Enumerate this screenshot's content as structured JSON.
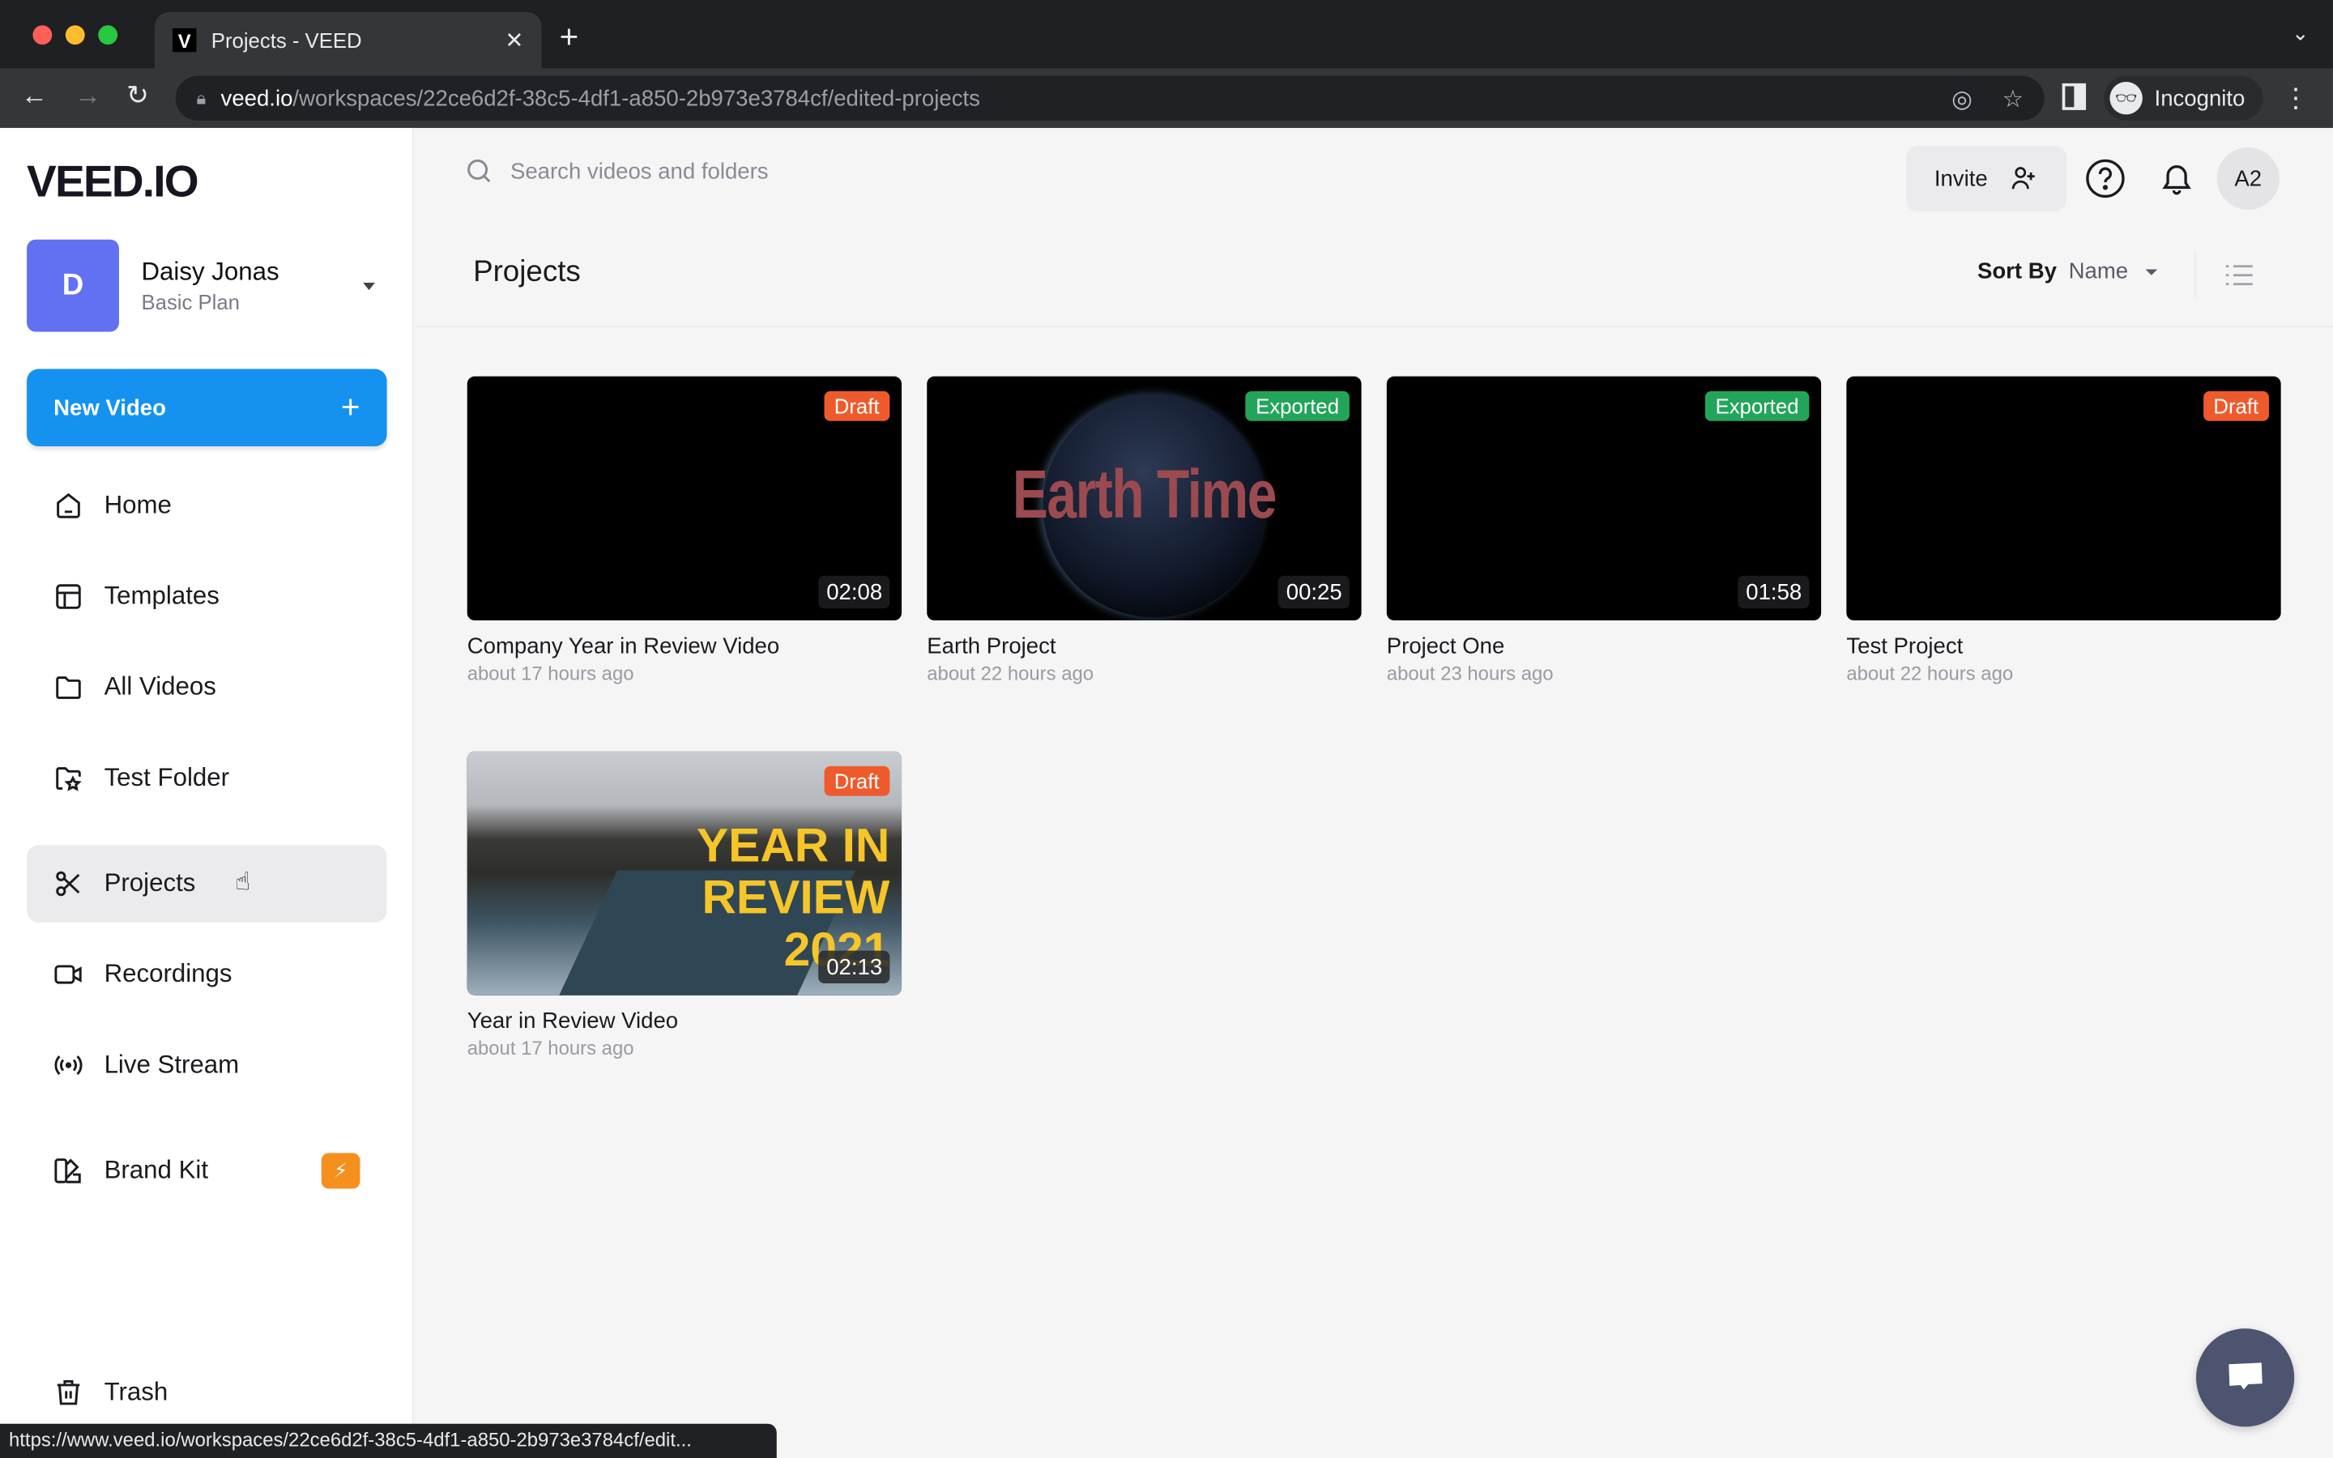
{
  "browser": {
    "tab_title": "Projects - VEED",
    "tab_favicon": "V",
    "url_host": "veed.io",
    "url_path": "/workspaces/22ce6d2f-38c5-4df1-a850-2b973e3784cf/edited-projects",
    "profile_label": "Incognito",
    "status_url": "https://www.veed.io/workspaces/22ce6d2f-38c5-4df1-a850-2b973e3784cf/edit..."
  },
  "sidebar": {
    "logo": "VEED.IO",
    "account": {
      "initial": "D",
      "name": "Daisy Jonas",
      "plan": "Basic Plan"
    },
    "new_video_label": "New Video",
    "items": [
      {
        "label": "Home",
        "icon": "home-icon"
      },
      {
        "label": "Templates",
        "icon": "templates-icon"
      },
      {
        "label": "All Videos",
        "icon": "folder-icon"
      },
      {
        "label": "Test Folder",
        "icon": "folder-star-icon"
      },
      {
        "label": "Projects",
        "icon": "scissors-icon",
        "active": true
      },
      {
        "label": "Recordings",
        "icon": "video-camera-icon"
      },
      {
        "label": "Live Stream",
        "icon": "broadcast-icon"
      },
      {
        "label": "Brand Kit",
        "icon": "brand-kit-icon",
        "badge": "lightning-icon"
      },
      {
        "label": "Trash",
        "icon": "trash-icon"
      }
    ]
  },
  "header": {
    "search_placeholder": "Search videos and folders",
    "invite_label": "Invite",
    "user_initials": "A2"
  },
  "page": {
    "title": "Projects",
    "sort_label": "Sort By",
    "sort_value": "Name"
  },
  "projects": [
    {
      "title": "Company Year in Review Video",
      "time": "about 17 hours ago",
      "status": "Draft",
      "duration": "02:08",
      "thumb": "black"
    },
    {
      "title": "Earth Project",
      "time": "about 22 hours ago",
      "status": "Exported",
      "duration": "00:25",
      "thumb": "earth",
      "thumb_text": "Earth Time"
    },
    {
      "title": "Project One",
      "time": "about 23 hours ago",
      "status": "Exported",
      "duration": "01:58",
      "thumb": "black"
    },
    {
      "title": "Test Project",
      "time": "about 22 hours ago",
      "status": "Draft",
      "duration": "",
      "thumb": "black"
    },
    {
      "title": "Year in Review Video",
      "time": "about 17 hours ago",
      "status": "Draft",
      "duration": "02:13",
      "thumb": "year",
      "thumb_text": [
        "YEAR IN",
        "REVIEW",
        "2021"
      ]
    }
  ],
  "colors": {
    "primary": "#1592f0",
    "draft": "#ef5a2c",
    "exported": "#22a55a",
    "avatar": "#6270f2",
    "brand_badge": "#f5901e"
  }
}
